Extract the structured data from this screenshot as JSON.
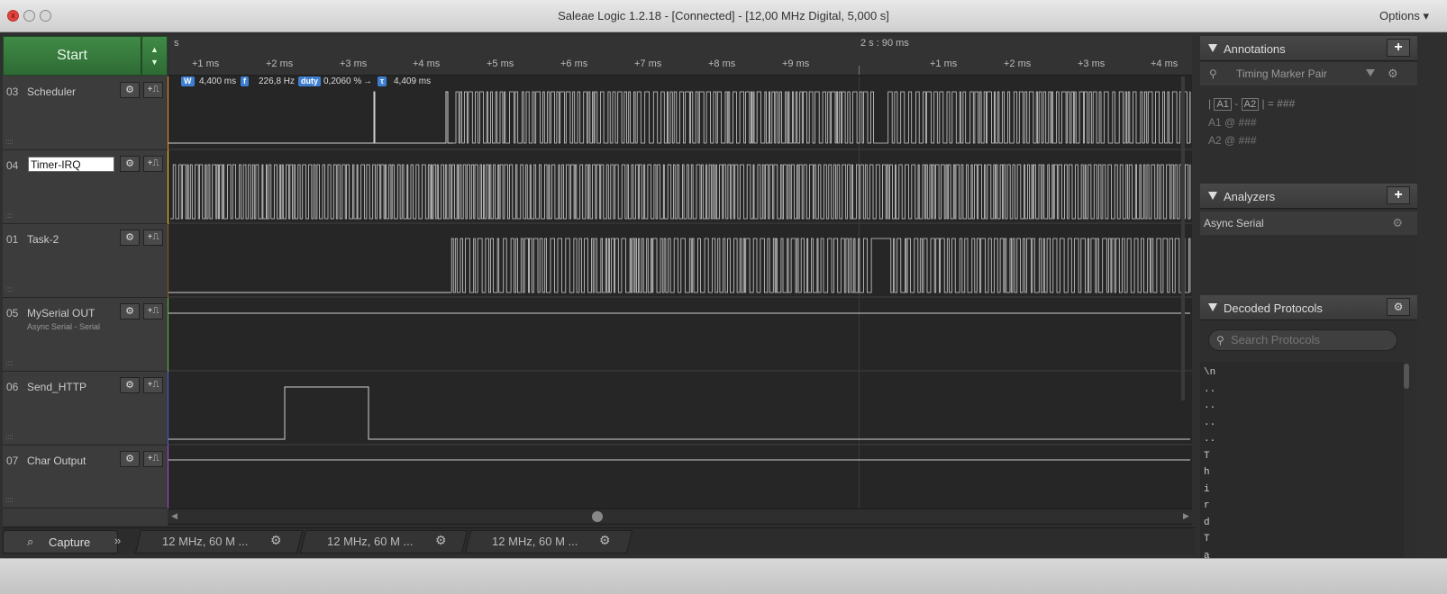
{
  "window": {
    "title": "Saleae Logic 1.2.18 - [Connected] - [12,00 MHz Digital, 5,000 s]",
    "options_label": "Options",
    "close_glyph": "x"
  },
  "capture": {
    "start_label": "Start"
  },
  "channels": [
    {
      "num": "03",
      "name": "Scheduler",
      "sub": "",
      "color": "#f08c1f"
    },
    {
      "num": "04",
      "name": "Timer-IRQ",
      "sub": "",
      "color": "#f5c518",
      "editing": true
    },
    {
      "num": "01",
      "name": "Task-2",
      "sub": "",
      "color": "#8a5a2c"
    },
    {
      "num": "05",
      "name": "MySerial OUT",
      "sub": "Async Serial - Serial",
      "color": "#67b83a"
    },
    {
      "num": "06",
      "name": "Send_HTTP",
      "sub": "",
      "color": "#4a5ad1"
    },
    {
      "num": "07",
      "name": "Char Output",
      "sub": "",
      "color": "#a54ad1"
    }
  ],
  "ruler": {
    "top_left": "s",
    "top_mark": "2 s : 90 ms",
    "ticks": [
      "+1 ms",
      "+2 ms",
      "+3 ms",
      "+4 ms",
      "+5 ms",
      "+6 ms",
      "+7 ms",
      "+8 ms",
      "+9 ms",
      "+1 ms",
      "+2 ms",
      "+3 ms",
      "+4 ms"
    ]
  },
  "measurements": {
    "width_badge": "W",
    "width_value": "4,400 ms",
    "freq_badge": "f",
    "freq_value": "226,8 Hz",
    "duty_badge": "duty",
    "duty_value": "0,2060 %",
    "period_badge": "τ",
    "period_value": "4,409 ms",
    "arrow": "→"
  },
  "annotations": {
    "title": "Annotations",
    "add": "+",
    "marker_label": "Timing Marker Pair",
    "formula_a1": "A1",
    "formula_a2": "A2",
    "formula_result": "= ###",
    "row1_label": "A1",
    "row1_value": "@  ###",
    "row2_label": "A2",
    "row2_value": "@  ###",
    "pipe": "|",
    "dash": "-"
  },
  "analyzers": {
    "title": "Analyzers",
    "add": "+",
    "items": [
      "Async Serial"
    ]
  },
  "decoded": {
    "title": "Decoded Protocols",
    "search_placeholder": "Search Protocols",
    "items": [
      "\\n",
      "..",
      "..",
      "..",
      "..",
      "T",
      "h",
      "i",
      "r",
      "d",
      "T",
      "a"
    ]
  },
  "tabs": {
    "capture": "Capture",
    "more": "»",
    "sessions": [
      "12 MHz, 60 M ...",
      "12 MHz, 60 M ...",
      "12 MHz, 60 M ..."
    ]
  },
  "icons": {
    "gear": "gear-icon",
    "trigger": "trigger-icon",
    "search": "search-icon",
    "pin": "pin-icon"
  }
}
